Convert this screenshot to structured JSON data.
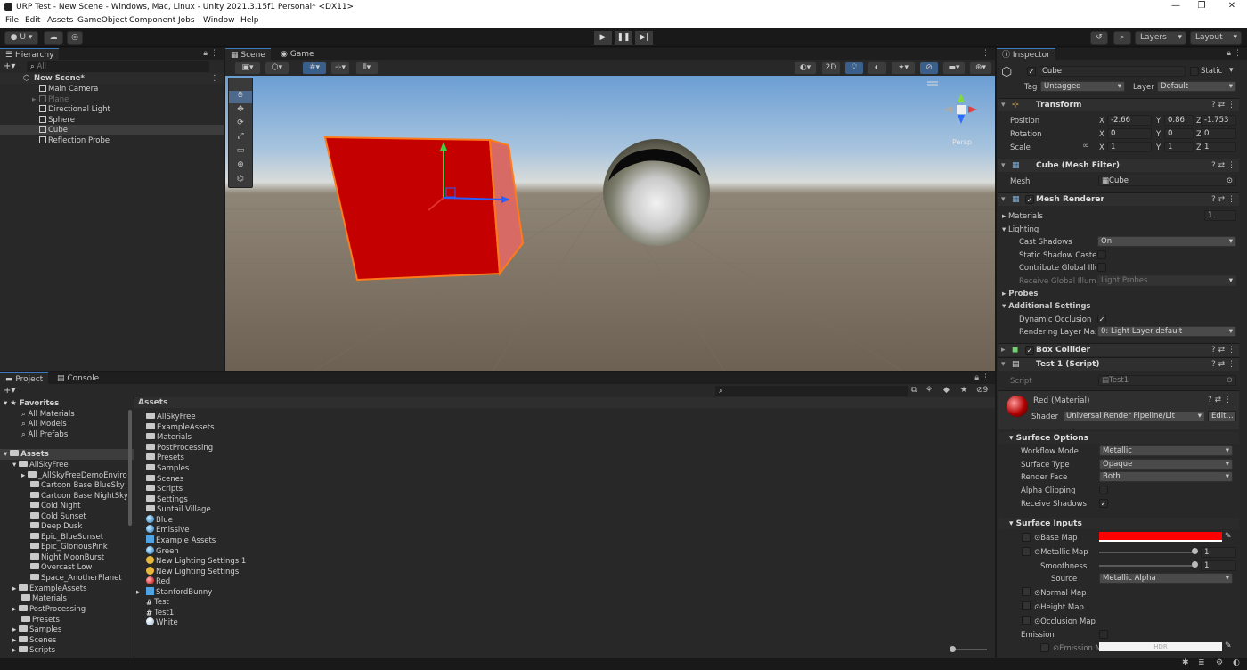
{
  "window": {
    "title": "URP Test - New Scene - Windows, Mac, Linux - Unity 2021.3.15f1 Personal* <DX11>",
    "controls": [
      "—",
      "❐",
      "✕"
    ]
  },
  "menu": [
    "File",
    "Edit",
    "Assets",
    "GameObject",
    "Component",
    "Jobs",
    "Window",
    "Help"
  ],
  "toolbar": {
    "account": "U ▾",
    "layers": "Layers",
    "layout": "Layout"
  },
  "hierarchy": {
    "tab": "Hierarchy",
    "search_placeholder": "All",
    "scene": "New Scene*",
    "items": [
      {
        "label": "Main Camera"
      },
      {
        "label": "Plane"
      },
      {
        "label": "Directional Light"
      },
      {
        "label": "Sphere"
      },
      {
        "label": "Cube"
      },
      {
        "label": "Reflection Probe"
      }
    ]
  },
  "scene_view": {
    "tabs": [
      "Scene",
      "Game"
    ],
    "mode_2d": "2D",
    "persp": "Persp"
  },
  "project": {
    "tabs": [
      "Project",
      "Console"
    ],
    "favorites_header": "Favorites",
    "favorites": [
      "All Materials",
      "All Models",
      "All Prefabs"
    ],
    "assets_header": "Assets",
    "tree": [
      {
        "label": "AllSkyFree",
        "depth": 1
      },
      {
        "label": "_AllSkyFreeDemoEnviro",
        "depth": 2
      },
      {
        "label": "Cartoon Base BlueSky",
        "depth": 3
      },
      {
        "label": "Cartoon Base NightSky",
        "depth": 3
      },
      {
        "label": "Cold Night",
        "depth": 3
      },
      {
        "label": "Cold Sunset",
        "depth": 3
      },
      {
        "label": "Deep Dusk",
        "depth": 3
      },
      {
        "label": "Epic_BlueSunset",
        "depth": 3
      },
      {
        "label": "Epic_GloriousPink",
        "depth": 3
      },
      {
        "label": "Night MoonBurst",
        "depth": 3
      },
      {
        "label": "Overcast Low",
        "depth": 3
      },
      {
        "label": "Space_AnotherPlanet",
        "depth": 3
      },
      {
        "label": "ExampleAssets",
        "depth": 1
      },
      {
        "label": "Materials",
        "depth": 1
      },
      {
        "label": "PostProcessing",
        "depth": 1
      },
      {
        "label": "Presets",
        "depth": 1
      },
      {
        "label": "Samples",
        "depth": 1
      },
      {
        "label": "Scenes",
        "depth": 1
      },
      {
        "label": "Scripts",
        "depth": 1
      }
    ],
    "breadcrumb": "Assets",
    "hidden_count": "9",
    "assets": [
      {
        "label": "AllSkyFree",
        "icon": "folder"
      },
      {
        "label": "ExampleAssets",
        "icon": "folder"
      },
      {
        "label": "Materials",
        "icon": "folder"
      },
      {
        "label": "PostProcessing",
        "icon": "folder"
      },
      {
        "label": "Presets",
        "icon": "folder"
      },
      {
        "label": "Samples",
        "icon": "folder"
      },
      {
        "label": "Scenes",
        "icon": "folder"
      },
      {
        "label": "Scripts",
        "icon": "folder"
      },
      {
        "label": "Settings",
        "icon": "folder"
      },
      {
        "label": "Suntail Village",
        "icon": "folder"
      },
      {
        "label": "Blue",
        "icon": "material"
      },
      {
        "label": "Emissive",
        "icon": "material"
      },
      {
        "label": "Example Assets",
        "icon": "prefab"
      },
      {
        "label": "Green",
        "icon": "material"
      },
      {
        "label": "New Lighting Settings 1",
        "icon": "lighting"
      },
      {
        "label": "New Lighting Settings",
        "icon": "lighting"
      },
      {
        "label": "Red",
        "icon": "material"
      },
      {
        "label": "StanfordBunny",
        "icon": "prefab"
      },
      {
        "label": "Test",
        "icon": "script"
      },
      {
        "label": "Test1",
        "icon": "script"
      },
      {
        "label": "White",
        "icon": "material"
      }
    ]
  },
  "inspector": {
    "tab": "Inspector",
    "object_name": "Cube",
    "static_label": "Static",
    "tag_label": "Tag",
    "tag_value": "Untagged",
    "layer_label": "Layer",
    "layer_value": "Default",
    "transform": {
      "title": "Transform",
      "position_label": "Position",
      "position": [
        "-2.66",
        "0.86",
        "-1.753"
      ],
      "rotation_label": "Rotation",
      "rotation": [
        "0",
        "0",
        "0"
      ],
      "scale_label": "Scale",
      "scale": [
        "1",
        "1",
        "1"
      ]
    },
    "mesh_filter": {
      "title": "Cube (Mesh Filter)",
      "mesh_label": "Mesh",
      "mesh_value": "Cube"
    },
    "mesh_renderer": {
      "title": "Mesh Renderer",
      "materials_label": "Materials",
      "materials_count": "1",
      "lighting_label": "Lighting",
      "cast_shadows_label": "Cast Shadows",
      "cast_shadows": "On",
      "static_shadow_label": "Static Shadow Caste",
      "contribute_gi_label": "Contribute Global Illu",
      "receive_gi_label": "Receive Global Illumi",
      "receive_gi": "Light Probes",
      "probes_label": "Probes",
      "additional_label": "Additional Settings",
      "dynamic_occlusion_label": "Dynamic Occlusion",
      "rendering_layer_label": "Rendering Layer Mas",
      "rendering_layer": "0: Light Layer default"
    },
    "box_collider": {
      "title": "Box Collider"
    },
    "script_comp": {
      "title": "Test 1 (Script)",
      "script_label": "Script",
      "script_value": "Test1"
    },
    "material": {
      "title": "Red (Material)",
      "shader_label": "Shader",
      "shader": "Universal Render Pipeline/Lit",
      "edit": "Edit...",
      "surface_options": "Surface Options",
      "workflow_label": "Workflow Mode",
      "workflow": "Metallic",
      "surface_type_label": "Surface Type",
      "surface_type": "Opaque",
      "render_face_label": "Render Face",
      "render_face": "Both",
      "alpha_clip_label": "Alpha Clipping",
      "receive_shadows_label": "Receive Shadows",
      "surface_inputs": "Surface Inputs",
      "base_map_label": "Base Map",
      "metallic_map_label": "Metallic Map",
      "metallic": "1",
      "smoothness_label": "Smoothness",
      "smoothness": "1",
      "source_label": "Source",
      "source": "Metallic Alpha",
      "normal_map_label": "Normal Map",
      "height_map_label": "Height Map",
      "occlusion_map_label": "Occlusion Map",
      "emission_label": "Emission",
      "emission_map_label": "Emission M",
      "hdr": "HDR"
    }
  },
  "colors": {
    "accent": "#3a79bb",
    "cube": "#c00000",
    "base_map": "#ff0000",
    "selection_outline": "#ff7a1a"
  }
}
